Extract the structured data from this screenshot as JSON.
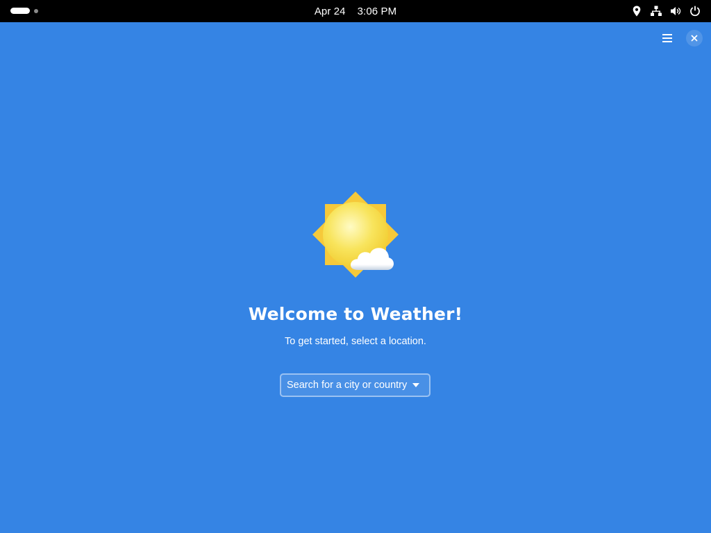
{
  "topbar": {
    "date": "Apr 24",
    "time": "3:06 PM",
    "tray_icons": [
      "location-icon",
      "network-icon",
      "volume-icon",
      "power-icon"
    ]
  },
  "window": {
    "background": "#3584e4",
    "header_buttons": [
      "menu-icon",
      "close-icon"
    ]
  },
  "welcome": {
    "title": "Welcome to Weather!",
    "subtitle": "To get started, select a location.",
    "search_label": "Search for a city or country"
  }
}
